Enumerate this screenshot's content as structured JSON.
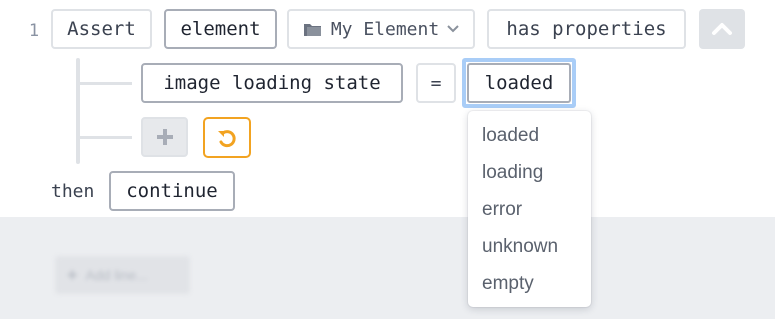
{
  "line": {
    "number": "1",
    "assert_label": "Assert",
    "subject_label": "element",
    "element_selector": {
      "icon": "folder-icon",
      "label": "My Element"
    },
    "has_properties_label": "has properties"
  },
  "condition": {
    "property": "image loading state",
    "operator": "=",
    "value": "loaded"
  },
  "then": {
    "label": "then",
    "action": "continue"
  },
  "dropdown": {
    "options": [
      "loaded",
      "loading",
      "error",
      "unknown",
      "empty"
    ]
  },
  "add_line": {
    "label": "Add line..."
  },
  "colors": {
    "accent_orange": "#f2a321",
    "focus_blue": "#a9cdf7",
    "token_border": "#dfe2e6",
    "panel_bg": "#eceef1"
  }
}
